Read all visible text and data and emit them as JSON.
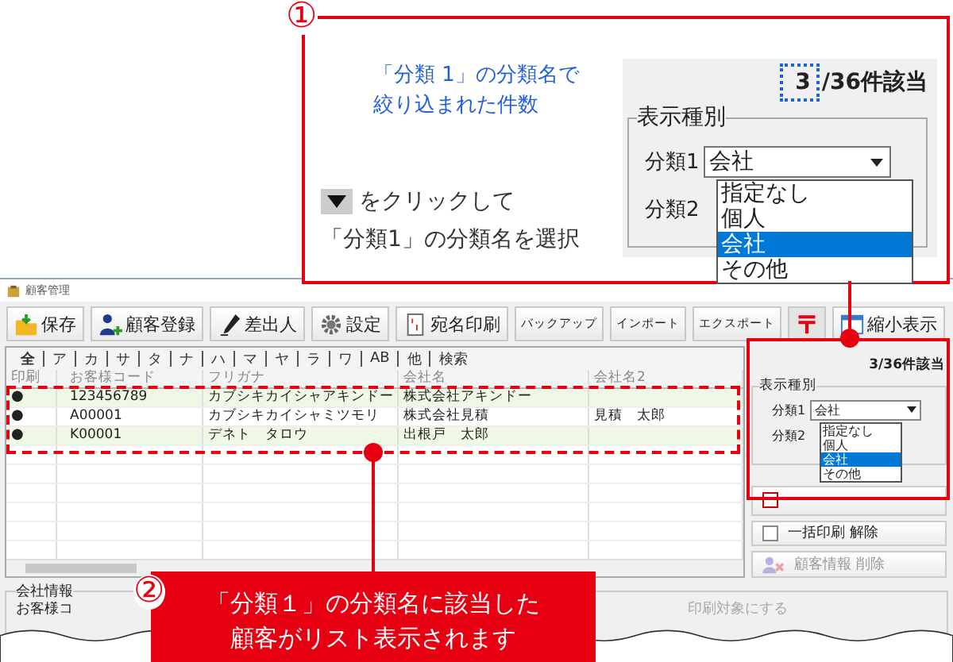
{
  "callout_1": {
    "number": "①",
    "note_lines": [
      "「分類 1」の分類名で",
      "絞り込まれた件数"
    ],
    "instruction_lines": [
      "をクリックして",
      "「分類1」の分類名を選択"
    ],
    "panel": {
      "count_value": "3",
      "count_rest": "/36件該当",
      "group_title": "表示種別",
      "filter_1_label": "分類1",
      "filter_1_value": "会社",
      "filter_2_label": "分類2",
      "options": [
        {
          "label": "指定なし",
          "selected": false
        },
        {
          "label": "個人",
          "selected": false
        },
        {
          "label": "会社",
          "selected": true
        },
        {
          "label": "その他",
          "selected": false
        }
      ]
    }
  },
  "window": {
    "title": "顧客管理",
    "toolbar": [
      {
        "label": "保存",
        "kind": "folder"
      },
      {
        "label": "顧客登録",
        "kind": "person"
      },
      {
        "label": "差出人",
        "kind": "pen"
      },
      {
        "label": "設定",
        "kind": "gear"
      },
      {
        "label": "宛名印刷",
        "kind": "label"
      },
      {
        "label": "バックアップ",
        "kind": "plain"
      },
      {
        "label": "インポート",
        "kind": "plain"
      },
      {
        "label": "エクスポート",
        "kind": "plain"
      },
      {
        "kind": "postal"
      },
      {
        "label": "縮小表示",
        "kind": "window"
      }
    ],
    "index_tabs": [
      {
        "label": "全",
        "selected": true
      },
      {
        "label": "ア",
        "selected": false
      },
      {
        "label": "カ",
        "selected": false
      },
      {
        "label": "サ",
        "selected": false
      },
      {
        "label": "タ",
        "selected": false
      },
      {
        "label": "ナ",
        "selected": false
      },
      {
        "label": "ハ",
        "selected": false
      },
      {
        "label": "マ",
        "selected": false
      },
      {
        "label": "ヤ",
        "selected": false
      },
      {
        "label": "ラ",
        "selected": false
      },
      {
        "label": "ワ",
        "selected": false
      },
      {
        "label": "AB",
        "selected": false
      },
      {
        "label": "他",
        "selected": false
      },
      {
        "label": "検索",
        "selected": false
      }
    ],
    "table": {
      "columns": [
        "印刷",
        "お客様コード",
        "フリガナ",
        "会社名",
        "会社名2"
      ],
      "rows": [
        [
          "●",
          "123456789",
          "カブシキカイシャアキンドー",
          "株式会社アキンドー",
          ""
        ],
        [
          "●",
          "A00001",
          "カブシキカイシャミツモリ",
          "株式会社見積",
          "見積　太郎"
        ],
        [
          "●",
          "K00001",
          "デネト　タロウ",
          "出根戸　太郎",
          ""
        ]
      ]
    },
    "side_panel": {
      "count": "3/36件該当",
      "group_title": "表示種別",
      "filter_1_label": "分類1",
      "filter_1_value": "会社",
      "filter_2_label": "分類2",
      "options": [
        {
          "label": "指定なし",
          "selected": false
        },
        {
          "label": "個人",
          "selected": false
        },
        {
          "label": "会社",
          "selected": true
        },
        {
          "label": "その他",
          "selected": false
        }
      ],
      "buttons": [
        {
          "label": "一括印刷 解除",
          "kind": "checkbox",
          "disabled": false
        },
        {
          "label": "顧客情報 削除",
          "kind": "delete",
          "disabled": true
        }
      ]
    },
    "company_info": {
      "title": "会社情報",
      "field_label": "お客様コ",
      "hint": "印刷対象にする"
    }
  },
  "callout_2": {
    "number": "②",
    "lines": [
      "「分類１」の分類名に該当した",
      "顧客がリスト表示されます"
    ]
  }
}
